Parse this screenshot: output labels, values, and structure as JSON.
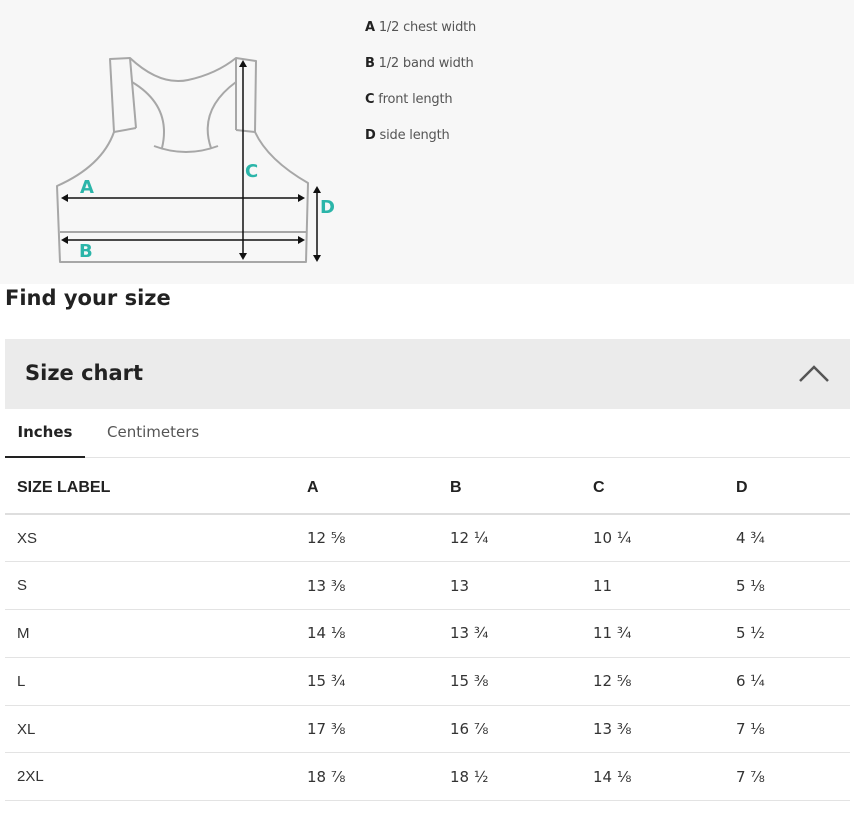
{
  "diagram": {
    "labels": [
      "A",
      "B",
      "C",
      "D"
    ],
    "accent_color": "#2bb5a9"
  },
  "legend": [
    {
      "key": "A",
      "text": "1/2 chest width"
    },
    {
      "key": "B",
      "text": "1/2 band width"
    },
    {
      "key": "C",
      "text": "front length"
    },
    {
      "key": "D",
      "text": "side length"
    }
  ],
  "find_title": "Find your size",
  "accordion": {
    "title": "Size chart",
    "expanded": true,
    "icon": "chevron-up-icon"
  },
  "tabs": [
    {
      "label": "Inches",
      "active": true
    },
    {
      "label": "Centimeters",
      "active": false
    }
  ],
  "table": {
    "headers": [
      "SIZE LABEL",
      "A",
      "B",
      "C",
      "D"
    ],
    "rows": [
      [
        "XS",
        "12 ⅝",
        "12 ¼",
        "10 ¼",
        "4 ¾"
      ],
      [
        "S",
        "13 ⅜",
        "13",
        "11",
        "5 ⅛"
      ],
      [
        "M",
        "14 ⅛",
        "13 ¾",
        "11 ¾",
        "5 ½"
      ],
      [
        "L",
        "15 ¾",
        "15 ⅜",
        "12 ⅝",
        "6 ¼"
      ],
      [
        "XL",
        "17 ⅜",
        "16 ⅞",
        "13 ⅜",
        "7 ⅛"
      ],
      [
        "2XL",
        "18 ⅞",
        "18 ½",
        "14 ⅛",
        "7 ⅞"
      ]
    ]
  }
}
